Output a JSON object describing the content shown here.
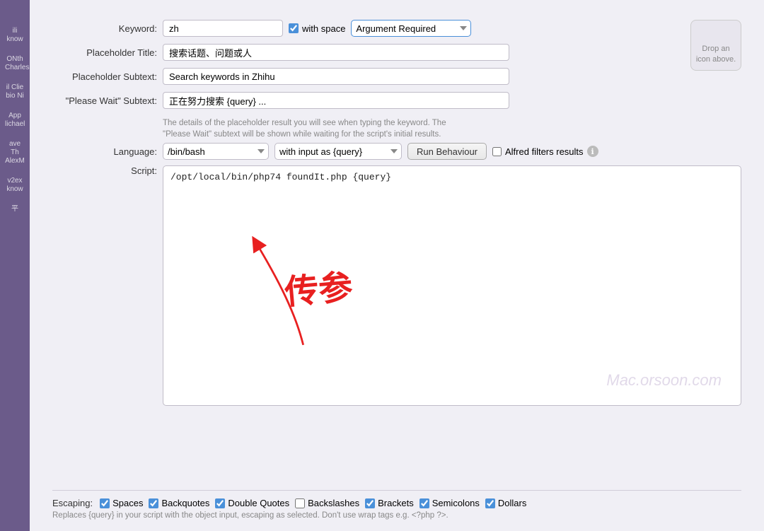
{
  "sidebar": {
    "items": [
      {
        "label": "ili\nknow",
        "id": "item1"
      },
      {
        "label": "ONth\nCharles",
        "id": "item2"
      },
      {
        "label": "il Clie\nbio Ni",
        "id": "item3"
      },
      {
        "label": "App\nlichael",
        "id": "item4"
      },
      {
        "label": "ave Th\nAlexM",
        "id": "item5"
      },
      {
        "label": "v2ex\nknow",
        "id": "item6"
      },
      {
        "label": "平",
        "id": "item7"
      }
    ]
  },
  "form": {
    "keyword_label": "Keyword:",
    "keyword_value": "zh",
    "with_space_label": "with space",
    "with_space_checked": true,
    "arg_required_label": "Argument Required",
    "placeholder_title_label": "Placeholder Title:",
    "placeholder_title_value": "搜索话题、问题或人",
    "placeholder_subtext_label": "Placeholder Subtext:",
    "placeholder_subtext_value": "Search keywords in Zhihu",
    "please_wait_label": "\"Please Wait\" Subtext:",
    "please_wait_value": "正在努力搜索 {query} ...",
    "desc_line1": "The details of the placeholder result you will see when typing the keyword. The",
    "desc_line2": "\"Please Wait\" subtext will be shown while waiting for the script's initial results.",
    "icon_drop_line1": "Drop an",
    "icon_drop_line2": "icon above.",
    "language_label": "Language:",
    "language_value": "/bin/bash",
    "with_input_value": "with input as {query}",
    "run_behaviour_label": "Run Behaviour",
    "alfred_filters_label": "Alfred filters results",
    "script_label": "Script:",
    "script_value": "/opt/local/bin/php74 foundIt.php {query}",
    "escaping_label": "Escaping:",
    "escaping_items": [
      {
        "label": "Spaces",
        "checked": true
      },
      {
        "label": "Backquotes",
        "checked": true
      },
      {
        "label": "Double Quotes",
        "checked": true
      },
      {
        "label": "Backslashes",
        "checked": false
      },
      {
        "label": "Brackets",
        "checked": true
      },
      {
        "label": "Semicolons",
        "checked": true
      },
      {
        "label": "Dollars",
        "checked": true
      }
    ],
    "escaping_desc": "Replaces {query} in your script with the object input, escaping as selected. Don't use wrap tags e.g. <?php ?>.",
    "watermark": "Mac.orsoon.com",
    "annotation_chinese": "传参"
  }
}
